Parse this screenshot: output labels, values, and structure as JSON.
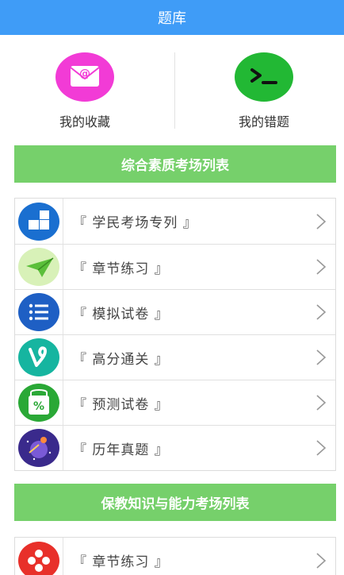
{
  "header": {
    "title": "题库"
  },
  "quick": {
    "favorites": {
      "label": "我的收藏",
      "icon": "mail-icon",
      "color": "#f23bd6"
    },
    "mistakes": {
      "label": "我的错题",
      "icon": "terminal-icon",
      "color": "#22b834"
    }
  },
  "sections": [
    {
      "title": "综合素质考场列表",
      "items": [
        {
          "label": "『 学民考场专列 』",
          "icon": "blocks-icon"
        },
        {
          "label": "『 章节练习 』",
          "icon": "paper-plane-icon"
        },
        {
          "label": "『 模拟试卷 』",
          "icon": "list-icon"
        },
        {
          "label": "『 高分通关 』",
          "icon": "v-logo-icon"
        },
        {
          "label": "『 预测试卷 』",
          "icon": "shopping-bag-icon"
        },
        {
          "label": "『 历年真题 』",
          "icon": "galaxy-icon"
        }
      ]
    },
    {
      "title": "保教知识与能力考场列表",
      "items": [
        {
          "label": "『 章节练习 』",
          "icon": "flower-icon"
        }
      ]
    }
  ]
}
